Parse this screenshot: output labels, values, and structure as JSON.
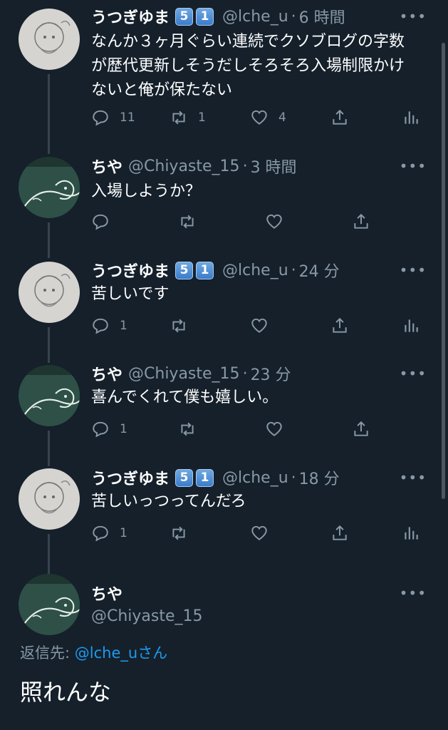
{
  "tweets": [
    {
      "name": "うつぎゆま",
      "badges": [
        "5",
        "1"
      ],
      "handle": "@lche_u",
      "time": "6 時間",
      "text_lines": [
        "なんか３ヶ月ぐらい連続でクソブログの字数",
        "が歴代更新しそうだしそろそろ入場制限かけ",
        "ないと俺が保たない"
      ],
      "reply_count": "11",
      "retweet_count": "1",
      "like_count": "4"
    },
    {
      "name": "ちや",
      "handle": "@Chiyaste_15",
      "time": "3 時間",
      "text_lines": [
        "入場しようか？"
      ]
    },
    {
      "name": "うつぎゆま",
      "badges": [
        "5",
        "1"
      ],
      "handle": "@lche_u",
      "time": "24 分",
      "text_lines": [
        "苦しいです"
      ],
      "reply_count": "1"
    },
    {
      "name": "ちや",
      "handle": "@Chiyaste_15",
      "time": "23 分",
      "text_lines": [
        "喜んでくれて僕も嬉しい。"
      ],
      "reply_count": "1"
    },
    {
      "name": "うつぎゆま",
      "badges": [
        "5",
        "1"
      ],
      "handle": "@lche_u",
      "time": "18 分",
      "text_lines": [
        "苦しいっつってんだろ"
      ],
      "reply_count": "1"
    }
  ],
  "focused_tweet": {
    "name": "ちや",
    "handle": "@Chiyaste_15",
    "reply_label": "返信先:",
    "reply_mention": "@lche_u",
    "reply_suffix": "さん",
    "text": "照れんな"
  },
  "ui": {
    "more_label": "•••",
    "dot": "·"
  },
  "colors": {
    "background": "#15202b",
    "muted": "#8899a6",
    "accent": "#1d9bf0",
    "thread_line": "#38444d"
  },
  "icons": [
    "reply-icon",
    "retweet-icon",
    "like-icon",
    "share-icon",
    "analytics-icon",
    "more-icon"
  ]
}
